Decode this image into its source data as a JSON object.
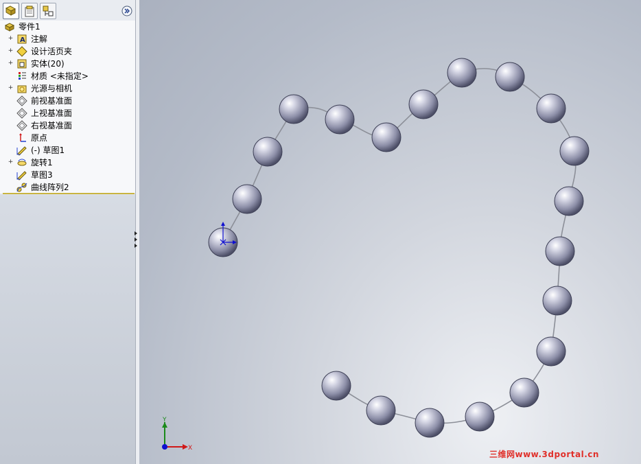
{
  "feature_tree": {
    "tabs": [
      "featuremanager-icon",
      "propertymanager-icon",
      "configurationmanager-icon"
    ],
    "more_icon": "double-chevron-right-icon",
    "items": [
      {
        "label": "零件1",
        "icon": "part-icon",
        "expandable": false
      },
      {
        "label": "注解",
        "icon": "annotation-icon",
        "expandable": true
      },
      {
        "label": "设计活页夹",
        "icon": "design-binder-icon",
        "expandable": true
      },
      {
        "label": "实体(20)",
        "icon": "solid-bodies-icon",
        "expandable": true
      },
      {
        "label": "材质 <未指定>",
        "icon": "material-icon",
        "expandable": false
      },
      {
        "label": "光源与相机",
        "icon": "lights-cameras-icon",
        "expandable": true
      },
      {
        "label": "前视基准面",
        "icon": "plane-icon",
        "expandable": false
      },
      {
        "label": "上视基准面",
        "icon": "plane-icon",
        "expandable": false
      },
      {
        "label": "右视基准面",
        "icon": "plane-icon",
        "expandable": false
      },
      {
        "label": "原点",
        "icon": "origin-icon",
        "expandable": false
      },
      {
        "label": "(-) 草图1",
        "icon": "sketch-icon",
        "expandable": false
      },
      {
        "label": "旋转1",
        "icon": "revolve-icon",
        "expandable": true
      },
      {
        "label": "草图3",
        "icon": "sketch-icon",
        "expandable": false
      },
      {
        "label": "曲线阵列2",
        "icon": "curve-pattern-icon",
        "expandable": false
      }
    ]
  },
  "triad": {
    "x_label": "X",
    "y_label": "Y"
  },
  "watermark": "三维网www.3dportal.cn",
  "colors": {
    "sphere": "#9a9cb4",
    "sphere_highlight": "#ffffff",
    "curve": "#8c8f98",
    "x_axis": "#d01818",
    "y_axis": "#1a8a1a",
    "origin": "#1010d0"
  }
}
